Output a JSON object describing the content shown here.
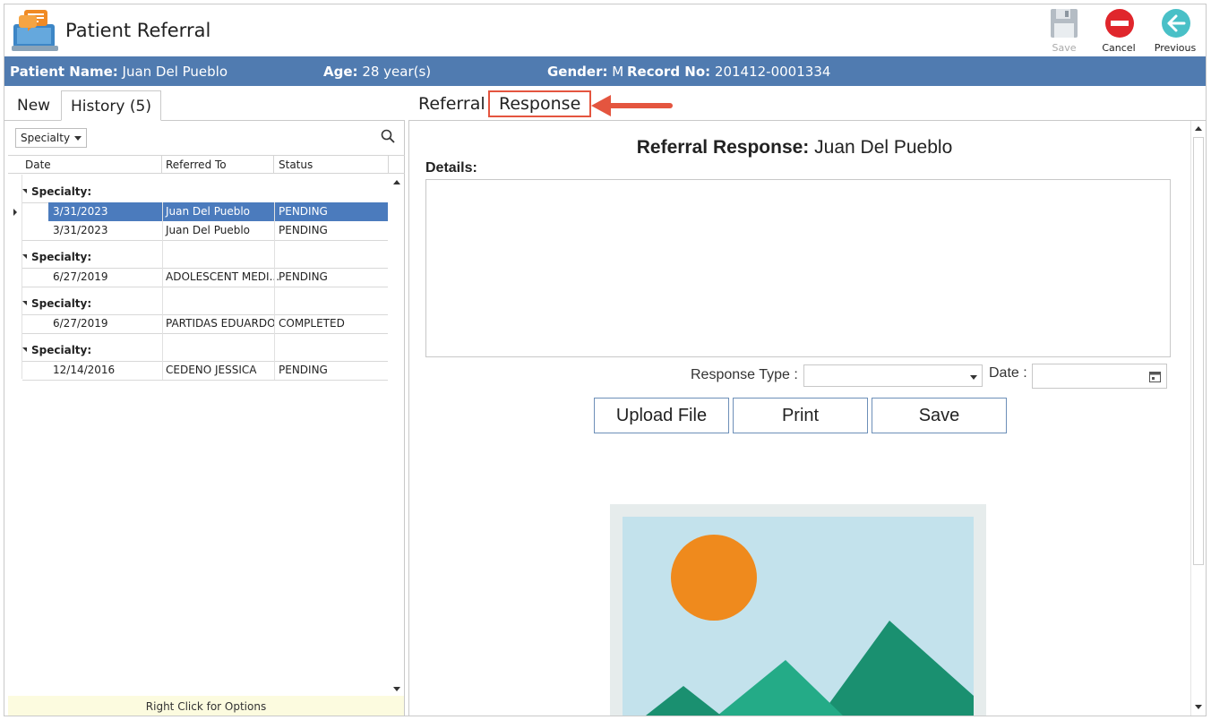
{
  "app": {
    "title": "Patient Referral",
    "icon": "chat-bubbles-laptop-icon"
  },
  "toolbar": {
    "save_label": "Save",
    "cancel_label": "Cancel",
    "previous_label": "Previous"
  },
  "patient": {
    "name_label": "Patient Name:",
    "name": "Juan Del Pueblo",
    "age_label": "Age:",
    "age": "28 year(s)",
    "gender_label": "Gender:",
    "gender": "M",
    "record_label": "Record No:",
    "record": "201412-0001334"
  },
  "left_tabs": {
    "new_label": "New",
    "history_label": "History",
    "history_count": "(5)"
  },
  "filter": {
    "selected": "Specialty"
  },
  "grid": {
    "columns": [
      "Date",
      "Referred To",
      "Status"
    ],
    "groups": [
      {
        "label": "Specialty:",
        "rows": [
          {
            "date": "3/31/2023",
            "referred_to": "Juan  Del Pueblo",
            "status": "PENDING",
            "selected": true
          },
          {
            "date": "3/31/2023",
            "referred_to": "Juan  Del Pueblo",
            "status": "PENDING",
            "selected": false
          }
        ]
      },
      {
        "label": "Specialty:",
        "rows": [
          {
            "date": "6/27/2019",
            "referred_to": "ADOLESCENT MEDI...",
            "status": "PENDING",
            "selected": false
          }
        ]
      },
      {
        "label": "Specialty:",
        "rows": [
          {
            "date": "6/27/2019",
            "referred_to": "PARTIDAS EDUARDO",
            "status": "COMPLETED",
            "selected": false
          }
        ]
      },
      {
        "label": "Specialty:",
        "rows": [
          {
            "date": "12/14/2016",
            "referred_to": "CEDENO JESSICA",
            "status": "PENDING",
            "selected": false
          }
        ]
      }
    ],
    "footer_hint": "Right Click for Options"
  },
  "right_tabs": {
    "referral_label": "Referral",
    "response_label": "Response"
  },
  "response": {
    "title_label": "Referral Response:",
    "title_name": "Juan  Del Pueblo",
    "details_label": "Details:",
    "details_value": "",
    "response_type_label": "Response Type :",
    "response_type_value": "",
    "date_label": "Date :",
    "date_value": "",
    "upload_label": "Upload File",
    "print_label": "Print",
    "save_label": "Save"
  },
  "colors": {
    "patient_bar": "#507bb0",
    "selected_row": "#4b7bbd",
    "annotation": "#e4553f"
  }
}
